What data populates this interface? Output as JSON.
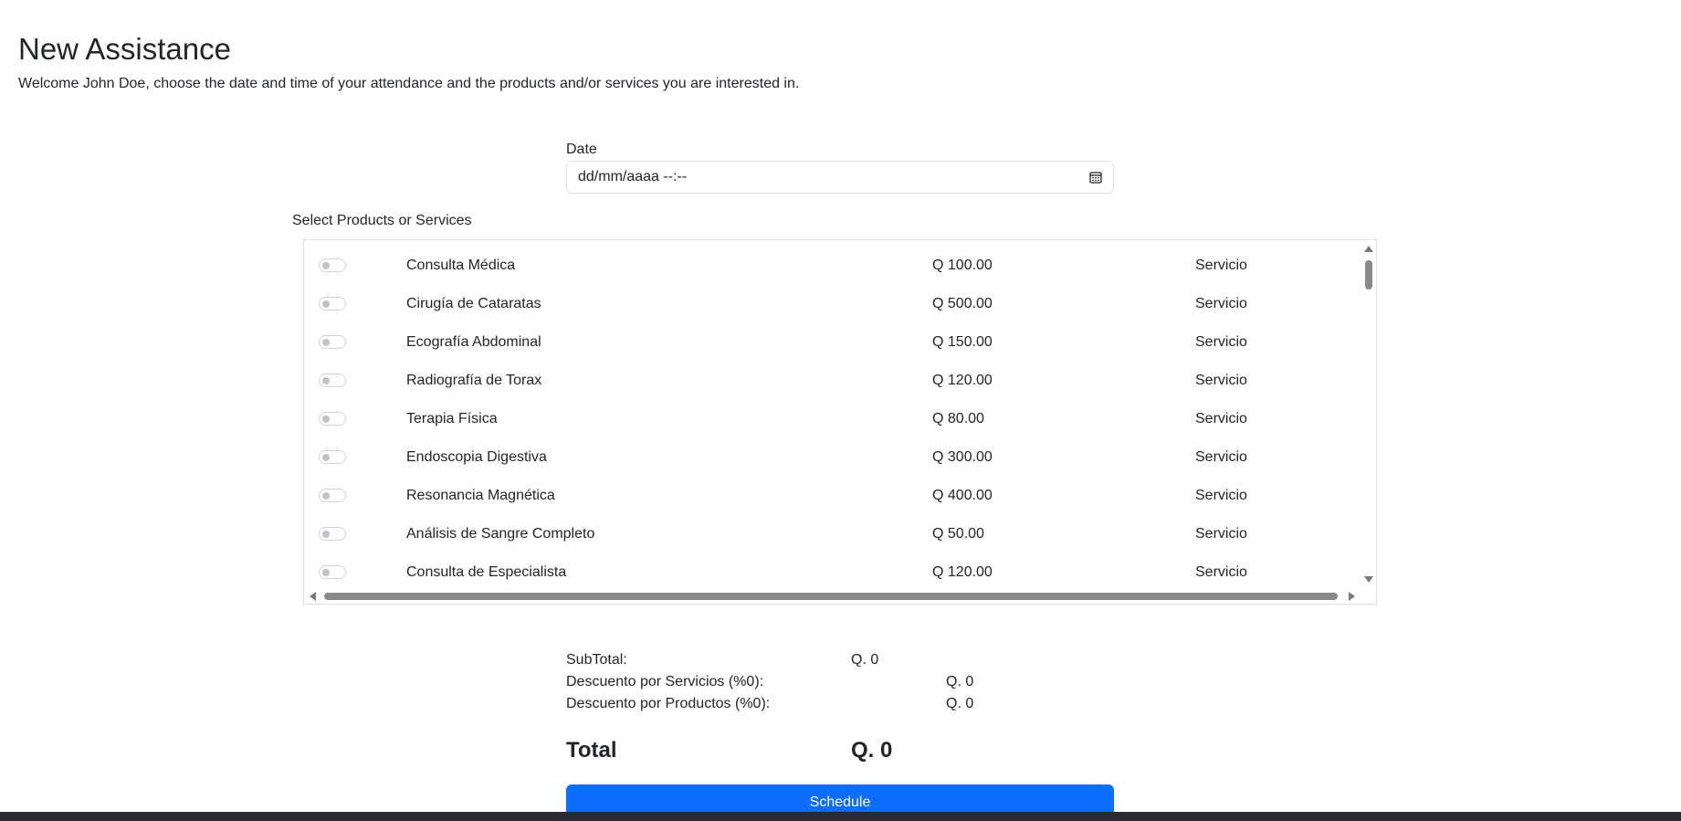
{
  "page": {
    "title": "New Assistance",
    "welcome": "Welcome John Doe, choose the date and time of your attendance and the products and/or services you are interested in."
  },
  "date_field": {
    "label": "Date",
    "placeholder": "dd/mm/aaaa --:--",
    "icon": "calendar-icon"
  },
  "products": {
    "label": "Select Products or Services",
    "rows": [
      {
        "name": "Consulta Médica",
        "price": "Q 100.00",
        "type": "Servicio",
        "selected": false
      },
      {
        "name": "Cirugía de Cataratas",
        "price": "Q 500.00",
        "type": "Servicio",
        "selected": false
      },
      {
        "name": "Ecografía Abdominal",
        "price": "Q 150.00",
        "type": "Servicio",
        "selected": false
      },
      {
        "name": "Radiografía de Torax",
        "price": "Q 120.00",
        "type": "Servicio",
        "selected": false
      },
      {
        "name": "Terapia Física",
        "price": "Q 80.00",
        "type": "Servicio",
        "selected": false
      },
      {
        "name": "Endoscopia Digestiva",
        "price": "Q 300.00",
        "type": "Servicio",
        "selected": false
      },
      {
        "name": "Resonancia Magnética",
        "price": "Q 400.00",
        "type": "Servicio",
        "selected": false
      },
      {
        "name": "Análisis de Sangre Completo",
        "price": "Q 50.00",
        "type": "Servicio",
        "selected": false
      },
      {
        "name": "Consulta de Especialista",
        "price": "Q 120.00",
        "type": "Servicio",
        "selected": false
      }
    ]
  },
  "summary": {
    "subtotal_label": "SubTotal:",
    "subtotal_value": "Q. 0",
    "service_discount_label": "Descuento por Servicios (%0):",
    "service_discount_value": "Q. 0",
    "product_discount_label": "Descuento por Productos (%0):",
    "product_discount_value": "Q. 0",
    "total_label": "Total",
    "total_value": "Q. 0"
  },
  "actions": {
    "schedule_label": "Schedule"
  },
  "colors": {
    "primary": "#0d6efd",
    "border": "#dee2e6",
    "text": "#212529"
  }
}
